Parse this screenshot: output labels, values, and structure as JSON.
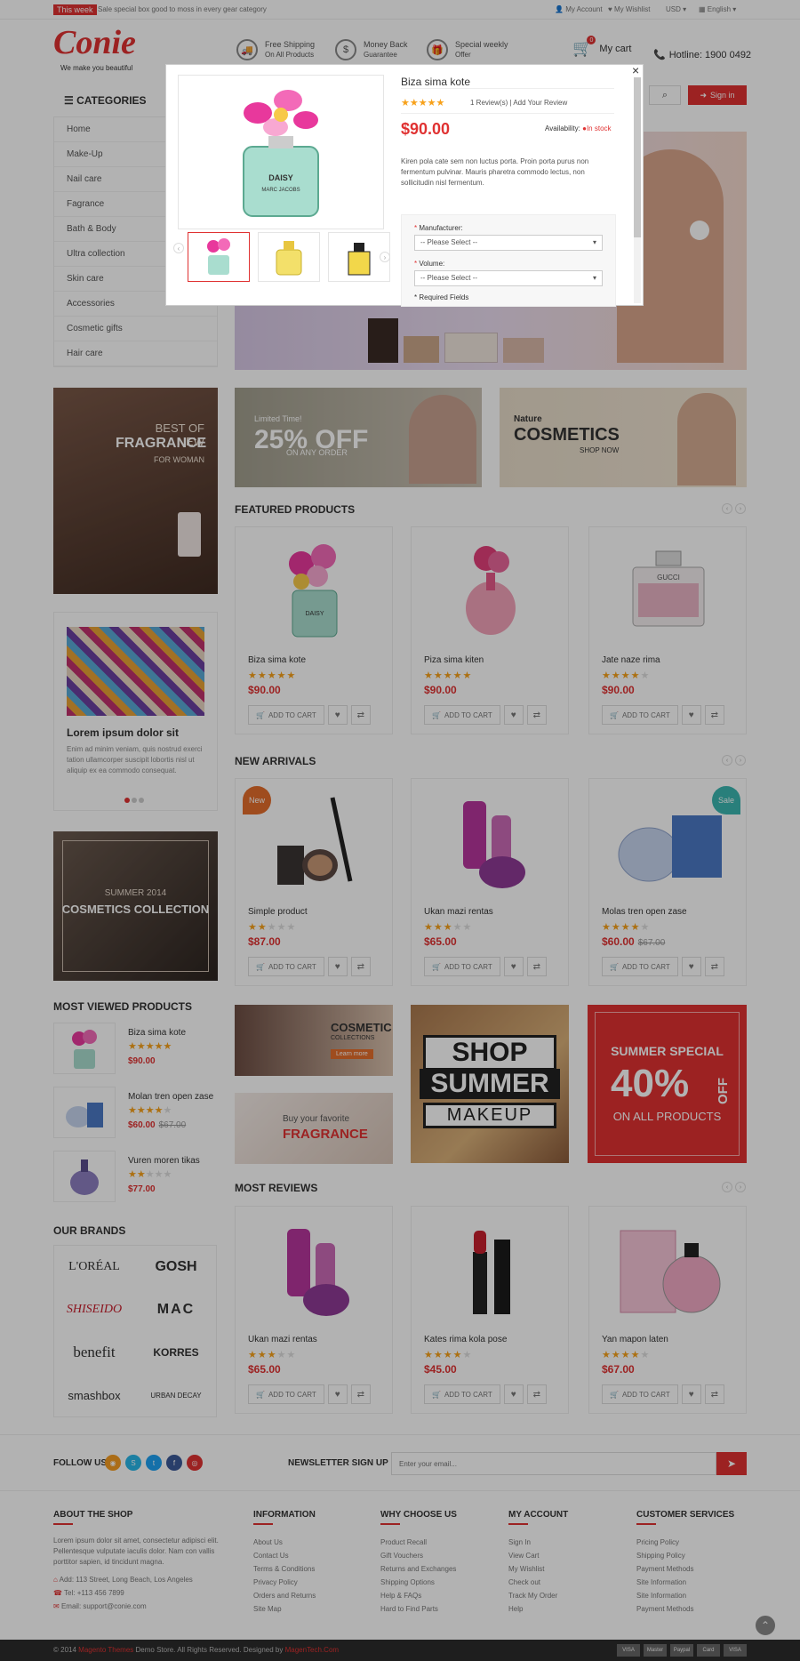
{
  "topbar": {
    "badge": "This week",
    "message": "Sale special box good to moss in every gear category",
    "my_account": "My Account",
    "my_wishlist": "My Wishlist",
    "currency": "USD",
    "language": "English"
  },
  "header": {
    "logo": "Conie",
    "tagline": "We make you beautiful",
    "features": [
      {
        "title": "Free Shipping",
        "sub": "On All Products"
      },
      {
        "title": "Money Back",
        "sub": "Guarantee"
      },
      {
        "title": "Special weekly",
        "sub": "Offer"
      }
    ],
    "cart_label": "My cart",
    "cart_count": "0",
    "hotline": "Hotline: 1900 0492"
  },
  "nav": {
    "categories_label": "CATEGORIES",
    "signin": "Sign in"
  },
  "categories": [
    "Home",
    "Make-Up",
    "Nail care",
    "Fagrance",
    "Bath & Body",
    "Ultra collection",
    "Skin care",
    "Accessories",
    "Cosmetic gifts",
    "Hair care"
  ],
  "banners": {
    "fragrance_top": "BEST OF NEW",
    "fragrance_mid": "FRAGRANCE",
    "fragrance_sub": "FOR WOMAN",
    "limited": "Limited Time!",
    "pct": "25% OFF",
    "any_order": "ON ANY ORDER",
    "nature": "Nature",
    "cosmetics": "COSMETICS",
    "shop_now": "SHOP NOW"
  },
  "blog": {
    "title": "Lorem ipsum dolor sit",
    "text": "Enim ad minim veniam, quis nostrud exerci tation ullamcorper suscipit lobortis nisl ut aliquip ex ea commodo consequat."
  },
  "collection": {
    "summer": "SUMMER 2014",
    "title": "COSMETICS COLLECTION"
  },
  "sections": {
    "featured": "FEATURED PRODUCTS",
    "new_arrivals": "NEW ARRIVALS",
    "most_viewed": "MOST VIEWED PRODUCTS",
    "brands": "OUR BRANDS",
    "most_reviews": "MOST REVIEWS"
  },
  "add_to_cart": "ADD TO CART",
  "featured": [
    {
      "name": "Biza sima kote",
      "price": "$90.00",
      "rating": 4.5
    },
    {
      "name": "Piza sima kiten",
      "price": "$90.00",
      "rating": 4.5
    },
    {
      "name": "Jate naze rima",
      "price": "$90.00",
      "rating": 4
    }
  ],
  "new_arrivals": [
    {
      "name": "Simple product",
      "price": "$87.00",
      "rating": 2,
      "label": "New"
    },
    {
      "name": "Ukan mazi rentas",
      "price": "$65.00",
      "rating": 3
    },
    {
      "name": "Molas tren open zase",
      "price": "$60.00",
      "old_price": "$67.00",
      "rating": 4,
      "label": "Sale"
    }
  ],
  "most_viewed": [
    {
      "name": "Biza sima kote",
      "price": "$90.00",
      "rating": 4.5
    },
    {
      "name": "Molan tren open zase",
      "price": "$60.00",
      "old_price": "$67.00",
      "rating": 4
    },
    {
      "name": "Vuren moren tikas",
      "price": "$77.00",
      "rating": 2
    }
  ],
  "promo": {
    "cosmetic": "COSMETIC",
    "collections": "COLLECTIONS",
    "learn_more": "Learn more",
    "buy_fav": "Buy your favorite",
    "fragrance": "FRAGRANCE",
    "shop": "SHOP",
    "summer": "SUMMER",
    "makeup": "MAKEUP",
    "summer_special": "SUMMER SPECIAL",
    "forty": "40%",
    "off": "OFF",
    "on_all": "ON ALL PRODUCTS"
  },
  "brands": [
    "L'ORÉAL",
    "GOSH",
    "SHISEIDO",
    "MAC",
    "benefit",
    "KORRES",
    "smashbox",
    "URBAN DECAY"
  ],
  "most_reviews": [
    {
      "name": "Ukan mazi rentas",
      "price": "$65.00",
      "rating": 3
    },
    {
      "name": "Kates rima kola pose",
      "price": "$45.00",
      "rating": 3.5
    },
    {
      "name": "Yan mapon laten",
      "price": "$67.00",
      "rating": 3.5
    }
  ],
  "newsletter": {
    "follow": "FOLLOW US",
    "signup": "NEWSLETTER SIGN UP",
    "placeholder": "Enter your email..."
  },
  "footer": {
    "about_title": "ABOUT THE SHOP",
    "about_text": "Lorem ipsum dolor sit amet, consectetur adipisci elit. Pellentesque vulputate iaculis dolor. Nam con vallis porttitor sapien, id tincidunt magna.",
    "address": "Add: 113 Street, Long Beach, Los Angeles",
    "tel": "Tel: +113 456 7899",
    "email": "Email: support@conie.com",
    "cols": [
      {
        "title": "INFORMATION",
        "links": [
          "About Us",
          "Contact Us",
          "Terms & Conditions",
          "Privacy Policy",
          "Orders and Returns",
          "Site Map"
        ]
      },
      {
        "title": "WHY CHOOSE US",
        "links": [
          "Product Recall",
          "Gift Vouchers",
          "Returns and Exchanges",
          "Shipping Options",
          "Help & FAQs",
          "Hard to Find Parts"
        ]
      },
      {
        "title": "MY ACCOUNT",
        "links": [
          "Sign In",
          "View Cart",
          "My Wishlist",
          "Check out",
          "Track My Order",
          "Help"
        ]
      },
      {
        "title": "CUSTOMER SERVICES",
        "links": [
          "Pricing Policy",
          "Shipping Policy",
          "Payment Methods",
          "Site Information",
          "Site Information",
          "Payment Methods"
        ]
      }
    ],
    "copyright_pre": "© 2014",
    "copyright_link": "Magento Themes",
    "copyright_mid": "Demo Store. All Rights Reserved. Designed by",
    "copyright_by": "MagenTech.Com",
    "payments": [
      "VISA",
      "Master",
      "Paypal",
      "Card",
      "VISA"
    ]
  },
  "modal": {
    "title": "Biza sima kote",
    "reviews": "1 Review(s) | Add Your Review",
    "rating": 4.5,
    "price": "$90.00",
    "availability_label": "Availability:",
    "availability": "In stock",
    "description": "Kiren pola cate sem non luctus porta. Proin porta purus non fermentum pulvinar. Mauris pharetra commodo lectus, non sollicitudin nisl fermentum.",
    "manufacturer_label": "Manufacturer:",
    "volume_label": "Volume:",
    "select_placeholder": "-- Please Select --",
    "required": "* Required Fields",
    "close": "×"
  }
}
